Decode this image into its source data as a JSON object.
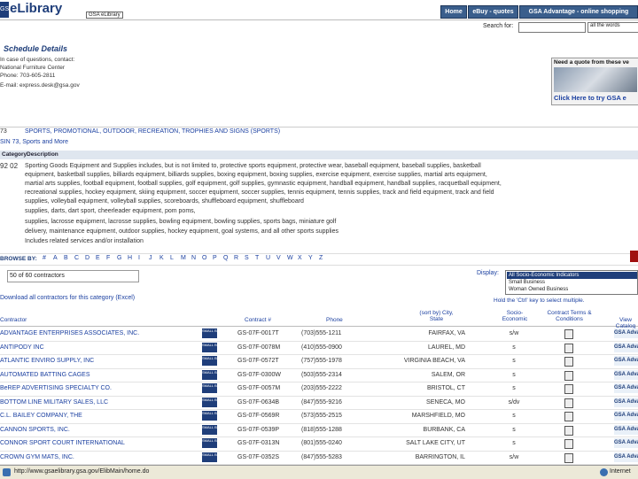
{
  "header": {
    "logo_mark": "GSA",
    "logo_text": "eLibrary",
    "gsa_tag": "GSA eLibrary",
    "nav": [
      "Home",
      "eBuy - quotes",
      "GSA Advantage - online shopping"
    ]
  },
  "search": {
    "label": "Search for:",
    "input_value": "",
    "scope": "all the words"
  },
  "schedule": {
    "title": "Schedule Details",
    "lines": [
      "In case of questions, contact:",
      "National Furniture Center",
      "Phone: 703-605-2811",
      "E-mail: express.desk@gsa.gov"
    ]
  },
  "ad": {
    "headline": "Need a quote from these ve",
    "link": "Click Here to try GSA e"
  },
  "category": {
    "code": "73",
    "title": "SPORTS, PROMOTIONAL, OUTDOOR, RECREATION, TROPHIES AND SIGNS (SPORTS)",
    "sub": "SIN 73, Sports and More",
    "desc_headers": [
      "Category",
      "Description"
    ],
    "desc_code": "92 02",
    "desc_lines": [
      "Sporting Goods Equipment and Supplies includes, but is not limited to, protective sports equipment, protective wear, baseball equipment, baseball supplies, basketball",
      "equipment, basketball supplies, billiards equipment, billiards supplies, boxing equipment, boxing supplies, exercise equipment, exercise supplies, martial arts equipment,",
      "martial arts supplies, football equipment, football supplies, golf equipment, golf supplies, gymnastic equipment, handball equipment, handball supplies, racquetball equipment,",
      "recreational supplies, hockey equipment, skiing equipment, soccer equipment, soccer supplies, tennis equipment, tennis supplies, track and field equipment, track and field",
      "supplies, volleyball equipment, volleyball supplies, scoreboards, shuffleboard equipment, shuffleboard",
      "supplies, darts, dart sport, cheerleader equipment, pom poms,",
      "supplies, lacrosse equipment, lacrosse supplies, bowling equipment, bowling supplies, sports bags, miniature golf",
      "delivery, maintenance equipment, outdoor supplies, hockey equipment, goal systems, and all other sports supplies",
      "Includes related services and/or installation"
    ]
  },
  "browse": {
    "label": "BROWSE BY:",
    "letters": [
      "#",
      "A",
      "B",
      "C",
      "D",
      "E",
      "F",
      "G",
      "H",
      "I",
      "J",
      "K",
      "L",
      "M",
      "N",
      "O",
      "P",
      "Q",
      "R",
      "S",
      "T",
      "U",
      "V",
      "W",
      "X",
      "Y",
      "Z"
    ]
  },
  "results": {
    "count_text": "50 of 60 contractors",
    "download_link": "Download all contractors for this category (Excel)",
    "display_label": "Display:",
    "filter_options": [
      "All Socio-Economic Indicators",
      "Small Business",
      "Woman Owned Business"
    ],
    "hold_text": "Hold the 'Ctrl' key to select multiple."
  },
  "table": {
    "headers": [
      "Contractor",
      "Contract #",
      "Phone",
      "(sort by) City, State",
      "Socio-Economic",
      "Contract Terms & Conditions",
      "View Catalog"
    ],
    "gsa_label": "GSA Advantage",
    "badge_text": "SMALL BIZ",
    "rows": [
      {
        "name": "ADVANTAGE ENTERPRISES ASSOCIATES, INC.",
        "contract": "GS-07F-0017T",
        "phone": "(703)555-1211",
        "city": "FAIRFAX, VA",
        "soc": "s/w"
      },
      {
        "name": "ANTIPODY INC",
        "contract": "GS-07F-0078M",
        "phone": "(410)555-0900",
        "city": "LAUREL, MD",
        "soc": "s"
      },
      {
        "name": "ATLANTIC ENVIRO SUPPLY, INC",
        "contract": "GS-07F-0572T",
        "phone": "(757)555-1978",
        "city": "VIRGINIA BEACH, VA",
        "soc": "s"
      },
      {
        "name": "AUTOMATED BATTING CAGES",
        "contract": "GS-07F-0300W",
        "phone": "(503)555-2314",
        "city": "SALEM, OR",
        "soc": "s"
      },
      {
        "name": "BeREP ADVERTISING SPECIALTY CO.",
        "contract": "GS-07F-0057M",
        "phone": "(203)555-2222",
        "city": "BRISTOL, CT",
        "soc": "s"
      },
      {
        "name": "BOTTOM LINE MILITARY SALES, LLC",
        "contract": "GS-07F-0634B",
        "phone": "(847)555-9216",
        "city": "SENECA, MO",
        "soc": "s/dv"
      },
      {
        "name": "C.L. BAILEY COMPANY, THE",
        "contract": "GS-07F-0569R",
        "phone": "(573)555-2515",
        "city": "MARSHFIELD, MO",
        "soc": "s"
      },
      {
        "name": "CANNON SPORTS, INC.",
        "contract": "GS-07F-0539P",
        "phone": "(818)555-1288",
        "city": "BURBANK, CA",
        "soc": "s"
      },
      {
        "name": "CONNOR SPORT COURT INTERNATIONAL",
        "contract": "GS-07F-0313N",
        "phone": "(801)555-0240",
        "city": "SALT LAKE CITY, UT",
        "soc": "s"
      },
      {
        "name": "CROWN GYM MATS, INC.",
        "contract": "GS-07F-0352S",
        "phone": "(847)555-5283",
        "city": "BARRINGTON, IL",
        "soc": "s/w"
      }
    ]
  },
  "status": {
    "url": "http://www.gsaelibrary.gsa.gov/ElibMain/home.do",
    "zone": "Internet"
  },
  "colors": {
    "brand": "#1f3e7a",
    "link": "#1a3fa0",
    "nav": "#3a5e8c"
  }
}
